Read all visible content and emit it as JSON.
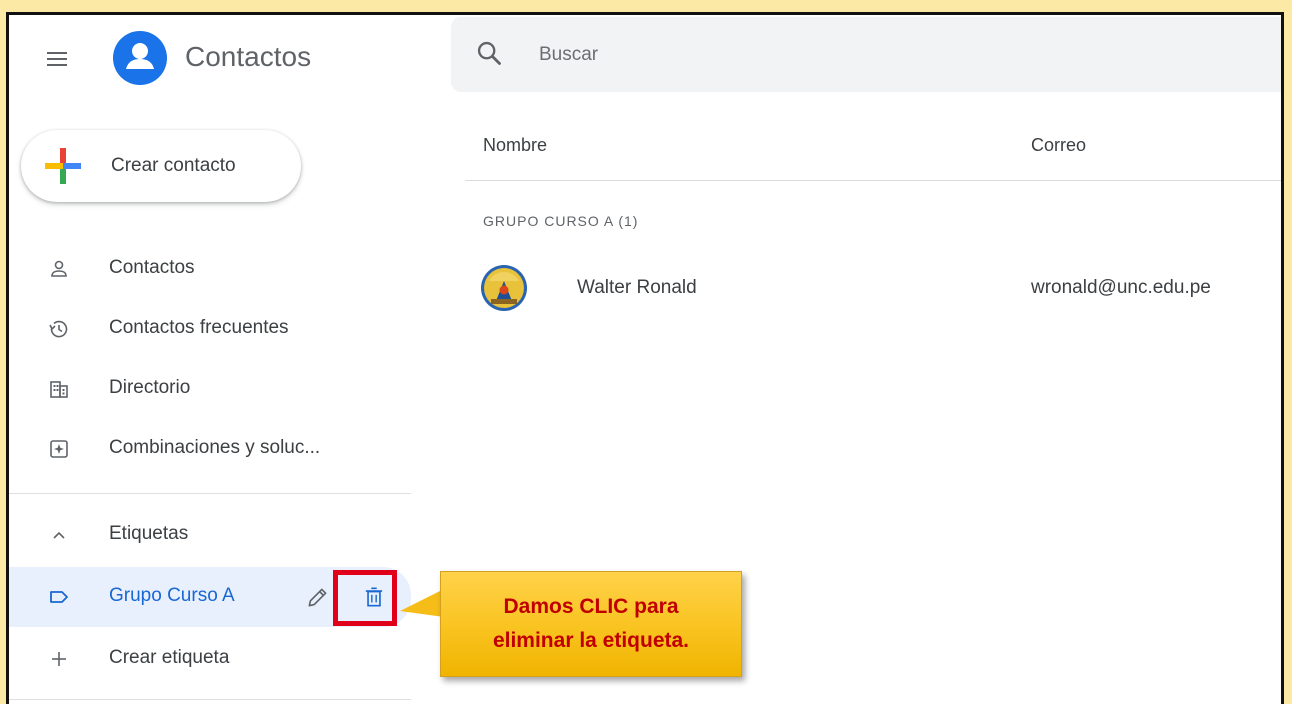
{
  "app": {
    "title": "Contactos"
  },
  "search": {
    "placeholder": "Buscar"
  },
  "create_button": {
    "label": "Crear contacto"
  },
  "sidebar": {
    "items": [
      {
        "label": "Contactos",
        "icon": "person-icon"
      },
      {
        "label": "Contactos frecuentes",
        "icon": "history-icon"
      },
      {
        "label": "Directorio",
        "icon": "domain-icon"
      },
      {
        "label": "Combinaciones y soluc...",
        "icon": "merge-icon"
      }
    ],
    "labels_section": {
      "label": "Etiquetas",
      "icon": "chevron-up-icon"
    },
    "label_items": [
      {
        "label": "Grupo Curso A",
        "icon": "label-icon"
      }
    ],
    "create_label": {
      "label": "Crear etiqueta",
      "icon": "add-icon"
    }
  },
  "table": {
    "columns": [
      "Nombre",
      "Correo"
    ],
    "group_title": "GRUPO CURSO A (1)",
    "rows": [
      {
        "name": "Walter Ronald",
        "email": "wronald@unc.edu.pe"
      }
    ]
  },
  "annotation": {
    "line1": "Damos CLIC para",
    "line2": "eliminar la etiqueta."
  },
  "colors": {
    "accent": "#1a73e8",
    "active_bg": "#e8f0fe",
    "highlight": "#e1001a",
    "callout": "#f9c31f",
    "callout_text": "#c00000"
  }
}
